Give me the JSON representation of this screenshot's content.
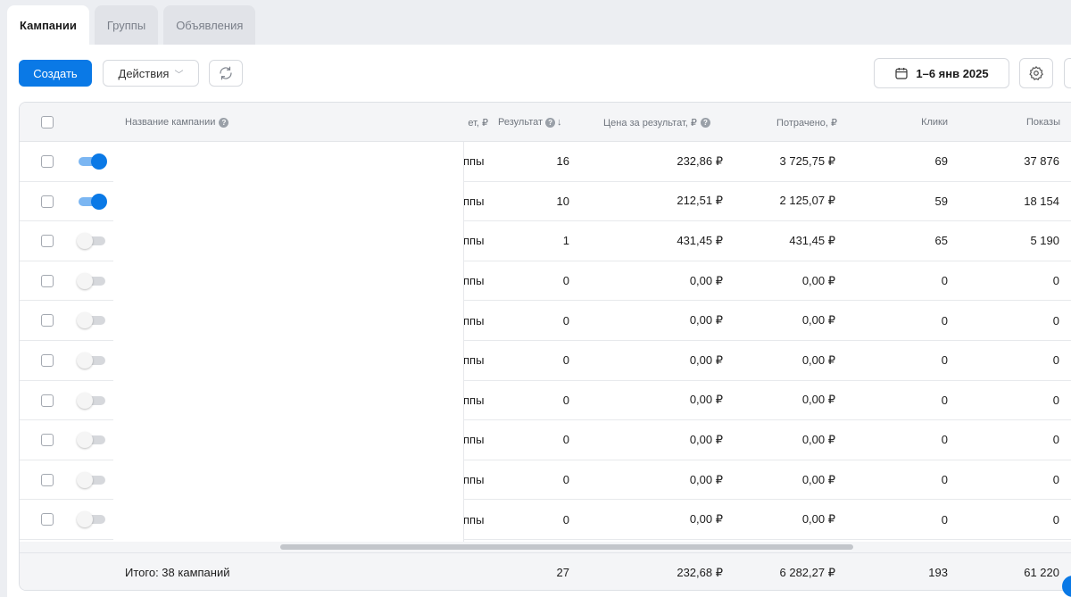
{
  "tabs": [
    {
      "label": "Кампании",
      "active": true
    },
    {
      "label": "Группы",
      "active": false
    },
    {
      "label": "Объявления",
      "active": false
    }
  ],
  "toolbar": {
    "create_label": "Создать",
    "actions_label": "Действия",
    "date_range": "1–6 янв 2025"
  },
  "columns": {
    "name": "Название кампании",
    "budget_partial": "ет, ₽",
    "result": "Результат",
    "cost_per_result": "Цена за результат, ₽",
    "spent": "Потрачено, ₽",
    "clicks": "Клики",
    "impressions": "Показы"
  },
  "rows": [
    {
      "enabled": true,
      "type_partial": "ппы",
      "result": "16",
      "cost_per_result": "232,86 ₽",
      "spent": "3 725,75 ₽",
      "clicks": "69",
      "impressions": "37 876"
    },
    {
      "enabled": true,
      "type_partial": "ппы",
      "result": "10",
      "cost_per_result": "212,51 ₽",
      "spent": "2 125,07 ₽",
      "clicks": "59",
      "impressions": "18 154"
    },
    {
      "enabled": false,
      "type_partial": "ппы",
      "result": "1",
      "cost_per_result": "431,45 ₽",
      "spent": "431,45 ₽",
      "clicks": "65",
      "impressions": "5 190"
    },
    {
      "enabled": false,
      "type_partial": "ппы",
      "result": "0",
      "cost_per_result": "0,00 ₽",
      "spent": "0,00 ₽",
      "clicks": "0",
      "impressions": "0"
    },
    {
      "enabled": false,
      "type_partial": "ппы",
      "result": "0",
      "cost_per_result": "0,00 ₽",
      "spent": "0,00 ₽",
      "clicks": "0",
      "impressions": "0"
    },
    {
      "enabled": false,
      "type_partial": "ппы",
      "result": "0",
      "cost_per_result": "0,00 ₽",
      "spent": "0,00 ₽",
      "clicks": "0",
      "impressions": "0"
    },
    {
      "enabled": false,
      "type_partial": "ппы",
      "result": "0",
      "cost_per_result": "0,00 ₽",
      "spent": "0,00 ₽",
      "clicks": "0",
      "impressions": "0"
    },
    {
      "enabled": false,
      "type_partial": "ппы",
      "result": "0",
      "cost_per_result": "0,00 ₽",
      "spent": "0,00 ₽",
      "clicks": "0",
      "impressions": "0"
    },
    {
      "enabled": false,
      "type_partial": "ппы",
      "result": "0",
      "cost_per_result": "0,00 ₽",
      "spent": "0,00 ₽",
      "clicks": "0",
      "impressions": "0"
    },
    {
      "enabled": false,
      "type_partial": "ппы",
      "result": "0",
      "cost_per_result": "0,00 ₽",
      "spent": "0,00 ₽",
      "clicks": "0",
      "impressions": "0"
    }
  ],
  "totals": {
    "label": "Итого: 38 кампаний",
    "result": "27",
    "cost_per_result": "232,68 ₽",
    "spent": "6 282,27 ₽",
    "clicks": "193",
    "impressions": "61 220"
  },
  "colors": {
    "accent": "#0a79e6",
    "toggle_on_track": "#7bb6f2",
    "toggle_off_track": "#d6d8dc"
  },
  "icons": {
    "refresh": "refresh-icon",
    "calendar": "calendar-icon",
    "settings": "gear-icon",
    "help": "question-icon",
    "sort": "arrow-down-icon"
  }
}
